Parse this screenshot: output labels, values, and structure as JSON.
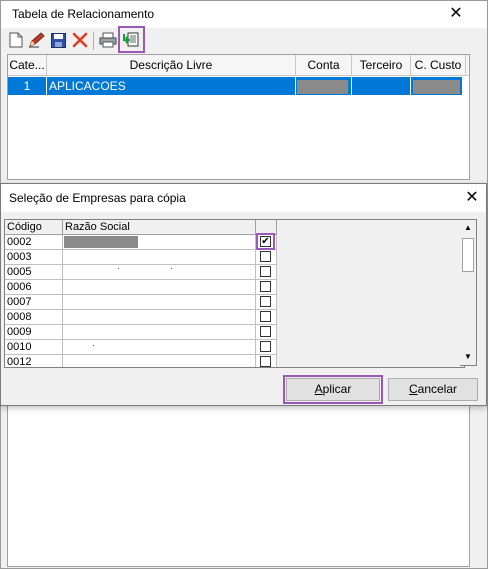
{
  "main_window": {
    "title": "Tabela de Relacionamento",
    "close_glyph": "✕",
    "toolbar": {
      "buttons": [
        "new-document-icon",
        "edit-pencil-icon",
        "save-disk-icon",
        "delete-x-icon",
        "print-icon",
        "copy-to-companies-icon"
      ],
      "highlight_color": "#9b59b6"
    },
    "grid": {
      "columns": [
        "Cate...",
        "Descrição Livre",
        "Conta",
        "Terceiro",
        "C. Custo"
      ],
      "rows": [
        {
          "categoria": "1",
          "descricao": "APLICACOES",
          "conta": "",
          "terceiro": "",
          "c_custo": ""
        }
      ],
      "selection_color": "#0078d7"
    }
  },
  "dialog": {
    "title": "Seleção de Empresas para cópia",
    "close_glyph": "✕",
    "columns": [
      "Código",
      "Razão Social",
      ""
    ],
    "rows": [
      {
        "codigo": "0002",
        "checked": true
      },
      {
        "codigo": "0003",
        "checked": false
      },
      {
        "codigo": "0005",
        "checked": false
      },
      {
        "codigo": "0006",
        "checked": false
      },
      {
        "codigo": "0007",
        "checked": false
      },
      {
        "codigo": "0008",
        "checked": false
      },
      {
        "codigo": "0009",
        "checked": false
      },
      {
        "codigo": "0010",
        "checked": false
      },
      {
        "codigo": "0012",
        "checked": false
      }
    ],
    "buttons": {
      "apply_label": "Aplicar",
      "cancel_label": "Cancelar"
    },
    "check_glyph": "✔",
    "scroll_up_glyph": "▲",
    "scroll_down_glyph": "▼"
  }
}
